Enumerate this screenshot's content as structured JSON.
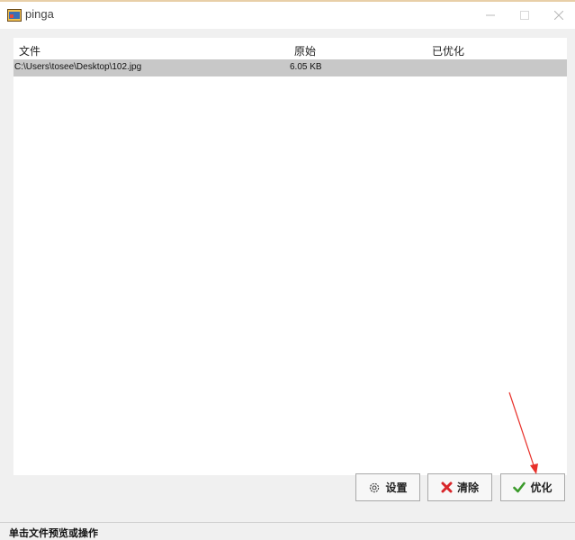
{
  "window": {
    "title": "pinga",
    "controls": [
      "minimize-icon",
      "maximize-icon",
      "close-icon"
    ]
  },
  "file_list": {
    "columns": [
      "文件",
      "原始",
      "已优化"
    ],
    "rows": [
      {
        "file": "C:\\Users\\tosee\\Desktop\\102.jpg",
        "original": "6.05 KB",
        "optimized": ""
      }
    ]
  },
  "buttons": {
    "settings": {
      "label": "设置",
      "icon": "gear-icon"
    },
    "clear": {
      "label": "清除",
      "icon": "red-x-icon"
    },
    "optimize": {
      "label": "优化",
      "icon": "green-check-icon"
    }
  },
  "status_bar": {
    "text": "单击文件预览或操作"
  },
  "colors": {
    "selected_row": "#c8c8c8",
    "arrow": "#e8302a",
    "clear_icon": "#d8262a",
    "optimize_icon": "#3a9a2a"
  }
}
